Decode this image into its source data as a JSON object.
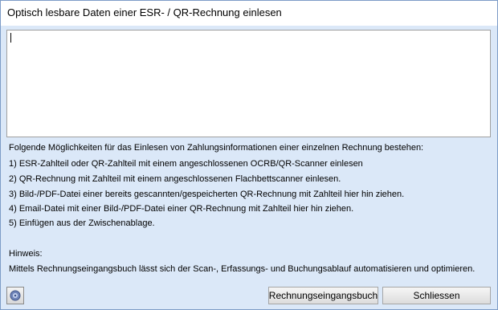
{
  "window": {
    "title": "Optisch lesbare Daten einer ESR- / QR-Rechnung einlesen"
  },
  "input": {
    "value": ""
  },
  "content": {
    "intro": "Folgende Möglichkeiten für das Einlesen von Zahlungsinformationen einer einzelnen Rechnung bestehen:",
    "options": [
      "1) ESR-Zahlteil oder QR-Zahlteil mit einem angeschlossenen OCRB/QR-Scanner einlesen",
      "2) QR-Rechnung mit Zahlteil mit einem angeschlossenen Flachbettscanner einlesen.",
      "3) Bild-/PDF-Datei einer bereits gescannten/gespeicherten QR-Rechnung mit Zahlteil hier hin ziehen.",
      "4) Email-Datei mit einer Bild-/PDF-Datei einer QR-Rechnung mit Zahlteil hier hin ziehen.",
      "5) Einfügen aus der Zwischenablage."
    ],
    "hint_label": "Hinweis:",
    "hint_text": "Mittels Rechnungseingangsbuch lässt sich der Scan-, Erfassungs- und Buchungsablauf automatisieren und optimieren."
  },
  "buttons": {
    "help_icon": "help-icon",
    "primary_label": "Rechnungseingangsbuch",
    "close_label": "Schliessen"
  },
  "colors": {
    "background": "#dbe8f8",
    "title_bar": "#ffffff",
    "border": "#7d9cc7"
  }
}
